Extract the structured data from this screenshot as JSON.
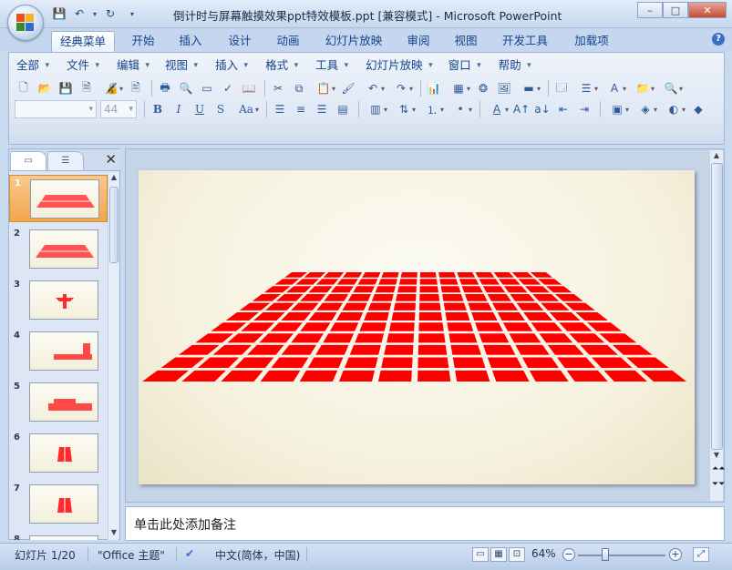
{
  "window": {
    "title": "倒计时与屏幕触摸效果ppt特效模板.ppt [兼容模式] - Microsoft PowerPoint",
    "minimize": "–",
    "maximize": "□",
    "close": "✕"
  },
  "ribbon_tabs": [
    {
      "label": "经典菜单",
      "active": true
    },
    {
      "label": "开始"
    },
    {
      "label": "插入"
    },
    {
      "label": "设计"
    },
    {
      "label": "动画"
    },
    {
      "label": "幻灯片放映"
    },
    {
      "label": "审阅"
    },
    {
      "label": "视图"
    },
    {
      "label": "开发工具"
    },
    {
      "label": "加载项"
    }
  ],
  "menu": [
    "全部",
    "文件",
    "编辑",
    "视图",
    "插入",
    "格式",
    "工具",
    "幻灯片放映",
    "窗口",
    "帮助"
  ],
  "font": {
    "name": "",
    "size": "44"
  },
  "format_buttons": {
    "bold": "B",
    "italic": "I",
    "underline": "U",
    "shadow": "S",
    "case": "Aa"
  },
  "panel": {
    "close": "✕"
  },
  "slides": [
    {
      "num": "1"
    },
    {
      "num": "2"
    },
    {
      "num": "3"
    },
    {
      "num": "4"
    },
    {
      "num": "5"
    },
    {
      "num": "6"
    },
    {
      "num": "7"
    },
    {
      "num": "8"
    }
  ],
  "notes_placeholder": "单击此处添加备注",
  "status": {
    "slide_info": "幻灯片 1/20",
    "theme": "\"Office 主题\"",
    "language": "中文(简体，中国)",
    "zoom": "64%",
    "zoom_level": 0.64
  },
  "colors": {
    "grid_red": "#ff0000",
    "selection": "#f0a64c"
  }
}
